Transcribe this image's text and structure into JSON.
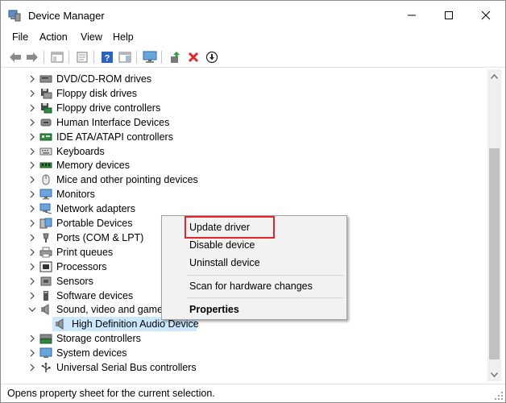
{
  "window": {
    "title": "Device Manager",
    "controls": {
      "minimize": "—",
      "maximize": "☐",
      "close": "✕"
    }
  },
  "menu": [
    "File",
    "Action",
    "View",
    "Help"
  ],
  "toolbar": {
    "buttons": [
      "back-arrow-icon",
      "forward-arrow-icon",
      "show-hide-console-tree-icon",
      "properties-icon",
      "help-icon",
      "action-pane-icon",
      "monitor-icon",
      "update-driver-icon",
      "uninstall-icon",
      "disable-device-icon"
    ],
    "accent_red": "#e0262b"
  },
  "tree": {
    "items": [
      {
        "label": "DVD/CD-ROM drives",
        "icon": "dvd-drive-icon",
        "expanded": false
      },
      {
        "label": "Floppy disk drives",
        "icon": "floppy-disk-icon",
        "expanded": false
      },
      {
        "label": "Floppy drive controllers",
        "icon": "floppy-controller-icon",
        "expanded": false
      },
      {
        "label": "Human Interface Devices",
        "icon": "hid-icon",
        "expanded": false
      },
      {
        "label": "IDE ATA/ATAPI controllers",
        "icon": "ide-controller-icon",
        "expanded": false
      },
      {
        "label": "Keyboards",
        "icon": "keyboard-icon",
        "expanded": false
      },
      {
        "label": "Memory devices",
        "icon": "memory-icon",
        "expanded": false
      },
      {
        "label": "Mice and other pointing devices",
        "icon": "mouse-icon",
        "expanded": false
      },
      {
        "label": "Monitors",
        "icon": "monitor-icon",
        "expanded": false
      },
      {
        "label": "Network adapters",
        "icon": "network-adapter-icon",
        "expanded": false
      },
      {
        "label": "Portable Devices",
        "icon": "portable-device-icon",
        "expanded": false
      },
      {
        "label": "Ports (COM & LPT)",
        "icon": "port-icon",
        "expanded": false
      },
      {
        "label": "Print queues",
        "icon": "printer-icon",
        "expanded": false
      },
      {
        "label": "Processors",
        "icon": "processor-icon",
        "expanded": false
      },
      {
        "label": "Sensors",
        "icon": "sensor-icon",
        "expanded": false
      },
      {
        "label": "Software devices",
        "icon": "software-device-icon",
        "expanded": false
      },
      {
        "label": "Sound, video and game c",
        "icon": "speaker-icon",
        "expanded": true
      },
      {
        "label": "High Definition Audio Device",
        "icon": "speaker-icon",
        "child": true,
        "selected": true
      },
      {
        "label": "Storage controllers",
        "icon": "storage-controller-icon",
        "expanded": false
      },
      {
        "label": "System devices",
        "icon": "system-device-icon",
        "expanded": false
      },
      {
        "label": "Universal Serial Bus controllers",
        "icon": "usb-icon",
        "expanded": false
      }
    ]
  },
  "context_menu": {
    "update_driver": "Update driver",
    "disable_device": "Disable device",
    "uninstall_device": "Uninstall device",
    "scan_hardware": "Scan for hardware changes",
    "properties": "Properties"
  },
  "status": {
    "text": "Opens property sheet for the current selection."
  }
}
